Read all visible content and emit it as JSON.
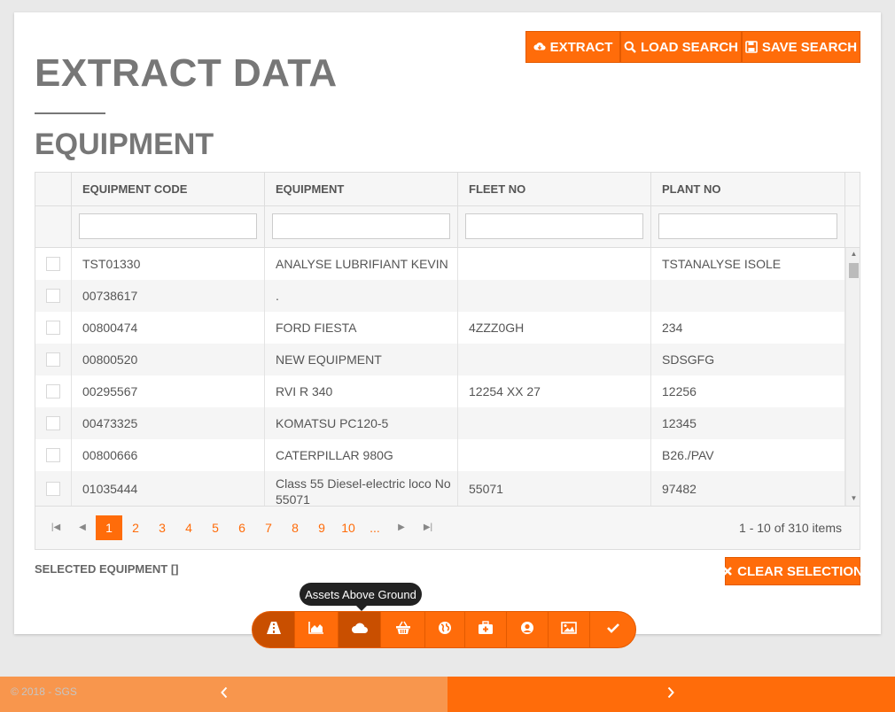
{
  "page": {
    "title": "EXTRACT DATA",
    "subtitle": "EQUIPMENT"
  },
  "toolbar": {
    "extract_label": "EXTRACT",
    "load_label": "LOAD SEARCH",
    "save_label": "SAVE SEARCH"
  },
  "table": {
    "columns": [
      "EQUIPMENT CODE",
      "EQUIPMENT",
      "FLEET NO",
      "PLANT NO"
    ],
    "rows": [
      {
        "code": "TST01330",
        "equipment": "ANALYSE LUBRIFIANT KEVIN",
        "fleet": "",
        "plant": "TSTANALYSE ISOLE"
      },
      {
        "code": "00738617",
        "equipment": ".",
        "fleet": "",
        "plant": ""
      },
      {
        "code": "00800474",
        "equipment": "FORD FIESTA",
        "fleet": "4ZZZ0GH",
        "plant": "234"
      },
      {
        "code": "00800520",
        "equipment": "NEW EQUIPMENT",
        "fleet": "",
        "plant": "SDSGFG"
      },
      {
        "code": "00295567",
        "equipment": "RVI R 340",
        "fleet": "12254 XX 27",
        "plant": "12256"
      },
      {
        "code": "00473325",
        "equipment": "KOMATSU PC120-5",
        "fleet": "",
        "plant": "12345"
      },
      {
        "code": "00800666",
        "equipment": "CATERPILLAR 980G",
        "fleet": "",
        "plant": "B26./PAV"
      },
      {
        "code": "01035444",
        "equipment": "Class 55 Diesel-electric loco No 55071",
        "fleet": "55071",
        "plant": "97482"
      }
    ]
  },
  "pager": {
    "pages": [
      "1",
      "2",
      "3",
      "4",
      "5",
      "6",
      "7",
      "8",
      "9",
      "10",
      "..."
    ],
    "active": "1",
    "info": "1 - 10 of 310 items"
  },
  "selection": {
    "label": "SELECTED EQUIPMENT []",
    "clear_label": "CLEAR SELECTION"
  },
  "dock": {
    "tooltip": "Assets Above Ground",
    "items": [
      "road-icon",
      "area-chart-icon",
      "cloud-icon",
      "basket-icon",
      "globe-icon",
      "medkit-icon",
      "user-circle-icon",
      "image-icon",
      "check-icon"
    ]
  },
  "footer": {
    "copyright": "© 2018 - SGS"
  },
  "colors": {
    "accent": "#ff6c0a",
    "accent_dark": "#c94f00",
    "footer_left": "#f8964d"
  }
}
